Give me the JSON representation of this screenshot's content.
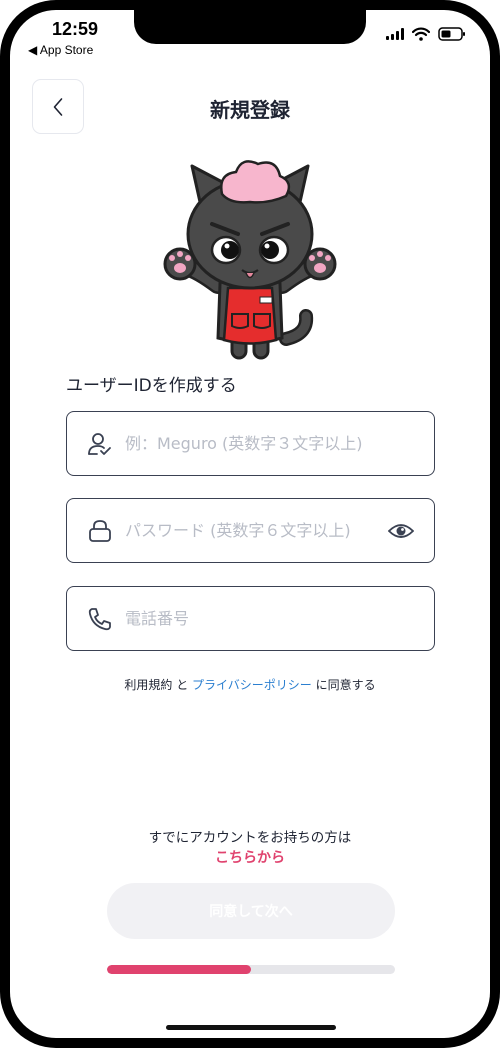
{
  "status_bar": {
    "time": "12:59",
    "back_label": "◀ App Store"
  },
  "header": {
    "title": "新規登録"
  },
  "form": {
    "section_label": "ユーザーIDを作成する",
    "user_id": {
      "placeholder": "例：Meguro (英数字３文字以上)",
      "value": ""
    },
    "password": {
      "placeholder": "パスワード (英数字６文字以上)",
      "value": ""
    },
    "phone": {
      "placeholder": "電話番号",
      "value": ""
    }
  },
  "terms": {
    "terms_link": "利用規約",
    "connector": "と",
    "privacy_link": "プライバシーポリシー",
    "suffix": "に同意する"
  },
  "login_prompt": {
    "text": "すでにアカウントをお持ちの方は",
    "link": "こちらから"
  },
  "next_button": {
    "label": "同意して次へ",
    "enabled": false
  },
  "progress": {
    "fraction": 0.5
  },
  "colors": {
    "accent": "#e0426e",
    "link": "#2b7fd0",
    "text": "#1f2433",
    "placeholder": "#b8bcc6",
    "button_disabled": "#f1f1f4"
  },
  "icons": {
    "back": "chevron-left-icon",
    "user": "user-check-icon",
    "password": "lock-icon",
    "visibility": "eye-icon",
    "phone": "phone-icon"
  }
}
